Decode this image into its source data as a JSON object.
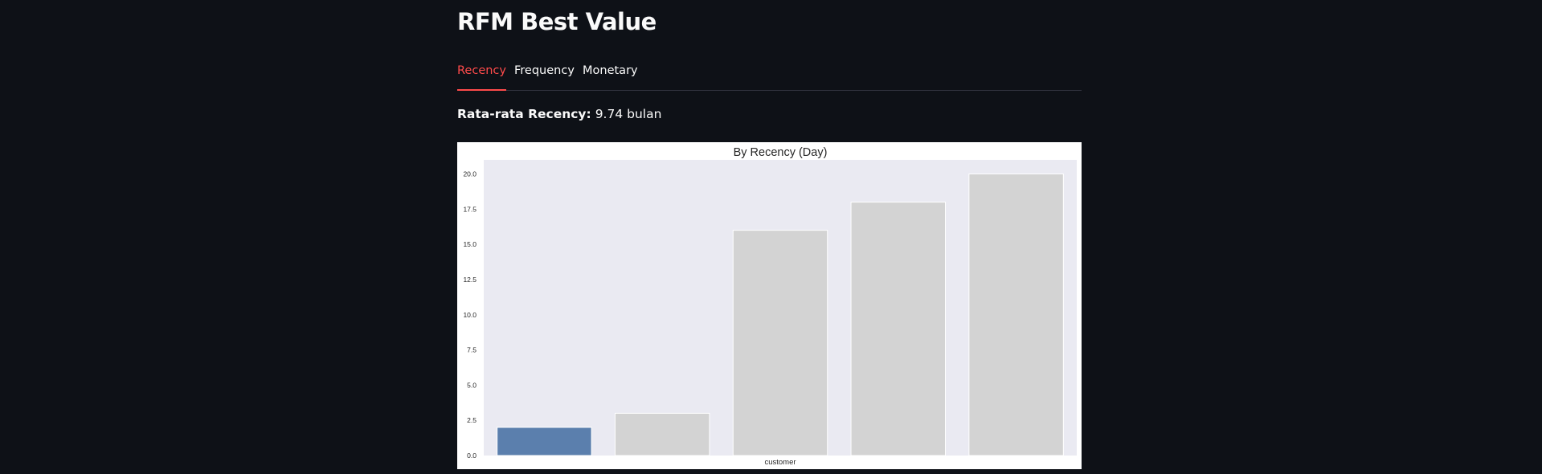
{
  "page": {
    "title": "RFM Best Value"
  },
  "tabs": [
    {
      "label": "Recency",
      "active": true
    },
    {
      "label": "Frequency",
      "active": false
    },
    {
      "label": "Monetary",
      "active": false
    }
  ],
  "metric": {
    "label": "Rata-rata Recency:",
    "value": "9.74 bulan"
  },
  "colors": {
    "background": "#0e1117",
    "active_tab": "#ff4b4b",
    "highlight_bar": "#5b7fad",
    "other_bars": "#d3d3d3",
    "plot_background": "#eaeaf2"
  },
  "chart_data": {
    "type": "bar",
    "title": "By Recency (Day)",
    "xlabel": "customer",
    "ylabel": "",
    "categories": [
      "",
      "",
      "",
      "",
      ""
    ],
    "values": [
      2,
      3,
      16,
      18,
      20
    ],
    "highlight_index": 0,
    "ylim": [
      0,
      21
    ],
    "yticks": [
      "0.0",
      "2.5",
      "5.0",
      "7.5",
      "10.0",
      "12.5",
      "15.0",
      "17.5",
      "20.0"
    ],
    "grid": false,
    "legend": "none"
  }
}
